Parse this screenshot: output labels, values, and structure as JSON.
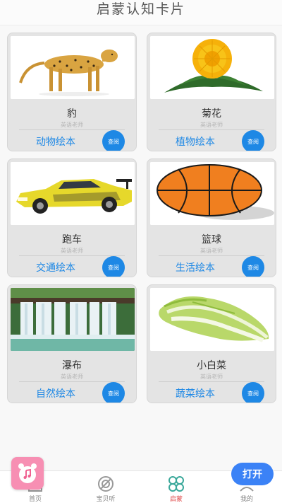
{
  "header": {
    "title": "启蒙认知卡片"
  },
  "cards": [
    {
      "name": "豹",
      "teacher": "英语老师",
      "category": "动物绘本",
      "view_label": "查阅",
      "image_icon": "cheetah"
    },
    {
      "name": "菊花",
      "teacher": "英语老师",
      "category": "植物绘本",
      "view_label": "查阅",
      "image_icon": "chrysanthemum"
    },
    {
      "name": "跑车",
      "teacher": "英语老师",
      "category": "交通绘本",
      "view_label": "查阅",
      "image_icon": "sports-car"
    },
    {
      "name": "篮球",
      "teacher": "英语老师",
      "category": "生活绘本",
      "view_label": "查阅",
      "image_icon": "basketball"
    },
    {
      "name": "瀑布",
      "teacher": "英语老师",
      "category": "自然绘本",
      "view_label": "查阅",
      "image_icon": "waterfall"
    },
    {
      "name": "小白菜",
      "teacher": "英语老师",
      "category": "蔬菜绘本",
      "view_label": "查阅",
      "image_icon": "bok-choy"
    }
  ],
  "tabbar": {
    "items": [
      {
        "label": "首页",
        "icon": "home-icon"
      },
      {
        "label": "宝贝听",
        "icon": "listen-icon"
      },
      {
        "label": "启蒙",
        "icon": "enlighten-icon",
        "active": true
      },
      {
        "label": "我的",
        "icon": "profile-icon"
      }
    ]
  },
  "overlay": {
    "open_label": "打开",
    "app_icon": "music-alarm-icon"
  },
  "colors": {
    "accent": "#1e88e5",
    "active_tab": "#e04c4c",
    "open_button": "#3b82f6",
    "app_icon_bg": "#f78fb3"
  }
}
